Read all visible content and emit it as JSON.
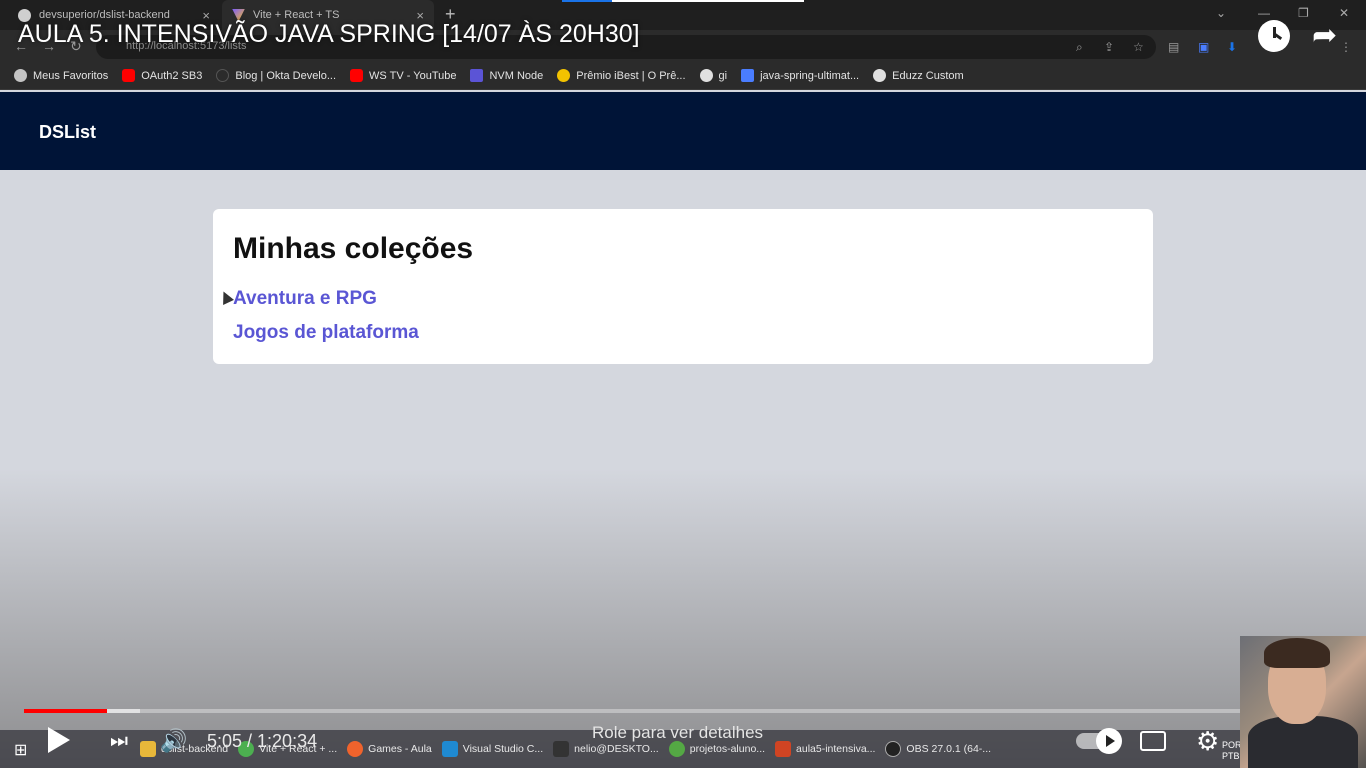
{
  "browser": {
    "tabs": [
      {
        "title": "devsuperior/dslist-backend",
        "icon": "github-icon"
      },
      {
        "title": "Vite + React + TS",
        "icon": "vite-icon"
      }
    ],
    "url": "http://localhost:5173/lists",
    "bookmarks": [
      {
        "label": "Meus Favoritos",
        "icon": "globe-icon",
        "color": "#c4c4c4"
      },
      {
        "label": "OAuth2 SB3",
        "icon": "youtube-icon",
        "color": "#ff0000"
      },
      {
        "label": "Blog | Okta Develo...",
        "icon": "okta-icon",
        "color": "#2b2b2b"
      },
      {
        "label": "WS TV - YouTube",
        "icon": "youtube-icon",
        "color": "#ff0000"
      },
      {
        "label": "NVM Node",
        "icon": "nvm-icon",
        "color": "#5b54d6"
      },
      {
        "label": "Prêmio iBest | O Prê...",
        "icon": "ibest-icon",
        "color": "#f2c200"
      },
      {
        "label": "gi",
        "icon": "github-icon",
        "color": "#e0e0e0"
      },
      {
        "label": "java-spring-ultimat...",
        "icon": "doc-icon",
        "color": "#4a7dff"
      },
      {
        "label": "Eduzz Custom",
        "icon": "github-icon",
        "color": "#e0e0e0"
      }
    ]
  },
  "app": {
    "brand": "DSList",
    "card_title": "Minhas coleções",
    "lists": [
      {
        "label": "Aventura e RPG"
      },
      {
        "label": "Jogos de plataforma"
      }
    ],
    "colors": {
      "header": "#001437",
      "link": "#5a56d4"
    }
  },
  "video": {
    "title": "AULA 5. INTENSIVÃO JAVA SPRING [14/07 ÀS 20H30]",
    "time": "5:05 / 1:20:34",
    "scroll_hint": "Role para ver detalhes",
    "progress_played_fraction": 0.068,
    "progress_buffered_fraction": 0.095
  },
  "taskbar": {
    "items": [
      {
        "label": "dslist-backend",
        "color": "#e8b83a"
      },
      {
        "label": "Vite + React + ...",
        "color": "#4caf50"
      },
      {
        "label": "Games - Aula",
        "color": "#f0632c"
      },
      {
        "label": "Visual Studio C...",
        "color": "#1f8ad2"
      },
      {
        "label": "nelio@DESKTO...",
        "color": "#333333"
      },
      {
        "label": "projetos-aluno...",
        "color": "#54a844"
      },
      {
        "label": "aula5-intensiva...",
        "color": "#d04423"
      },
      {
        "label": "OBS 27.0.1 (64-...",
        "color": "#222222"
      }
    ],
    "locale": "POR PTB"
  }
}
